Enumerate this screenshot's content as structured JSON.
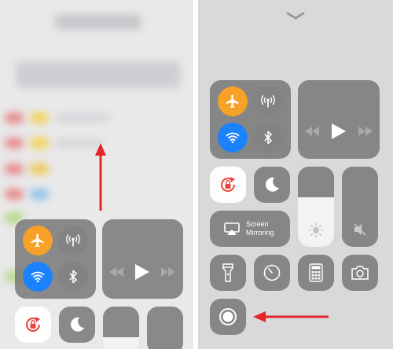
{
  "screen_mirroring": {
    "line1": "Screen",
    "line2": "Mirroring"
  },
  "brightness_level": 0.62,
  "left_brightness_level": 0.35,
  "colors": {
    "orange": "#f7a128",
    "blue": "#1a82fb",
    "arrow_red": "#e3252a",
    "rotation_lock_red": "#e8453c"
  },
  "icons": {
    "airplane": "airplane-icon",
    "cellular": "cellular-antenna-icon",
    "wifi": "wifi-icon",
    "bluetooth": "bluetooth-icon",
    "rewind": "rewind-icon",
    "play": "play-icon",
    "fast_forward": "fast-forward-icon",
    "rotation_lock": "rotation-lock-icon",
    "do_not_disturb": "moon-icon",
    "airplay": "airplay-icon",
    "sun": "sun-icon",
    "mute": "speaker-muted-icon",
    "flashlight": "flashlight-icon",
    "timer": "timer-icon",
    "calculator": "calculator-icon",
    "camera": "camera-icon",
    "screen_record": "screen-record-icon",
    "dismiss": "chevron-down-icon"
  }
}
